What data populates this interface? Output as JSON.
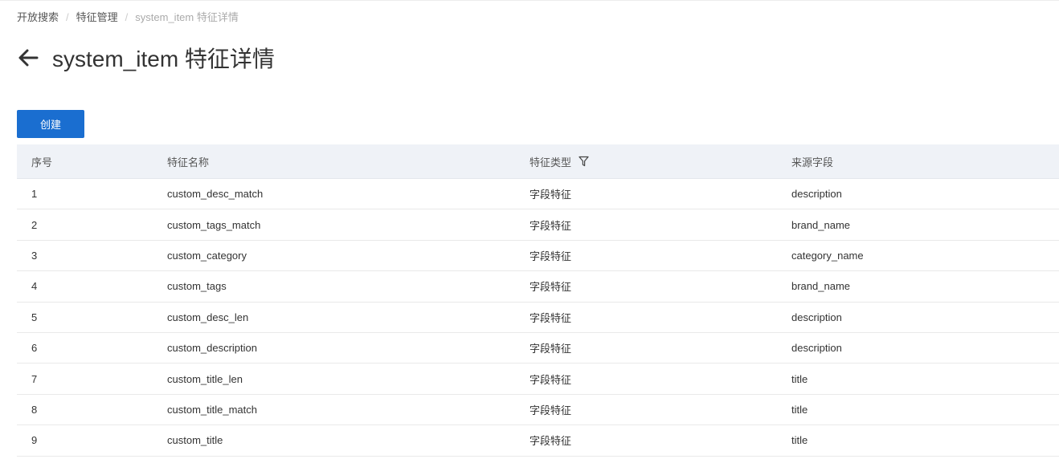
{
  "breadcrumb": {
    "items": [
      "开放搜索",
      "特征管理",
      "system_item 特征详情"
    ],
    "separator": "/"
  },
  "header": {
    "title": "system_item 特征详情",
    "back_icon": "arrow-left-icon"
  },
  "toolbar": {
    "create_label": "创建"
  },
  "table": {
    "columns": [
      "序号",
      "特征名称",
      "特征类型",
      "来源字段"
    ],
    "filter_icon": "filter-funnel-icon",
    "rows": [
      {
        "index": "1",
        "name": "custom_desc_match",
        "type": "字段特征",
        "source": "description"
      },
      {
        "index": "2",
        "name": "custom_tags_match",
        "type": "字段特征",
        "source": "brand_name"
      },
      {
        "index": "3",
        "name": "custom_category",
        "type": "字段特征",
        "source": "category_name"
      },
      {
        "index": "4",
        "name": "custom_tags",
        "type": "字段特征",
        "source": "brand_name"
      },
      {
        "index": "5",
        "name": "custom_desc_len",
        "type": "字段特征",
        "source": "description"
      },
      {
        "index": "6",
        "name": "custom_description",
        "type": "字段特征",
        "source": "description"
      },
      {
        "index": "7",
        "name": "custom_title_len",
        "type": "字段特征",
        "source": "title"
      },
      {
        "index": "8",
        "name": "custom_title_match",
        "type": "字段特征",
        "source": "title"
      },
      {
        "index": "9",
        "name": "custom_title",
        "type": "字段特征",
        "source": "title"
      }
    ]
  },
  "colors": {
    "primary": "#1a6ed0",
    "header_bg": "#eff2f7",
    "text": "#333333",
    "muted": "#aaaaaa"
  }
}
